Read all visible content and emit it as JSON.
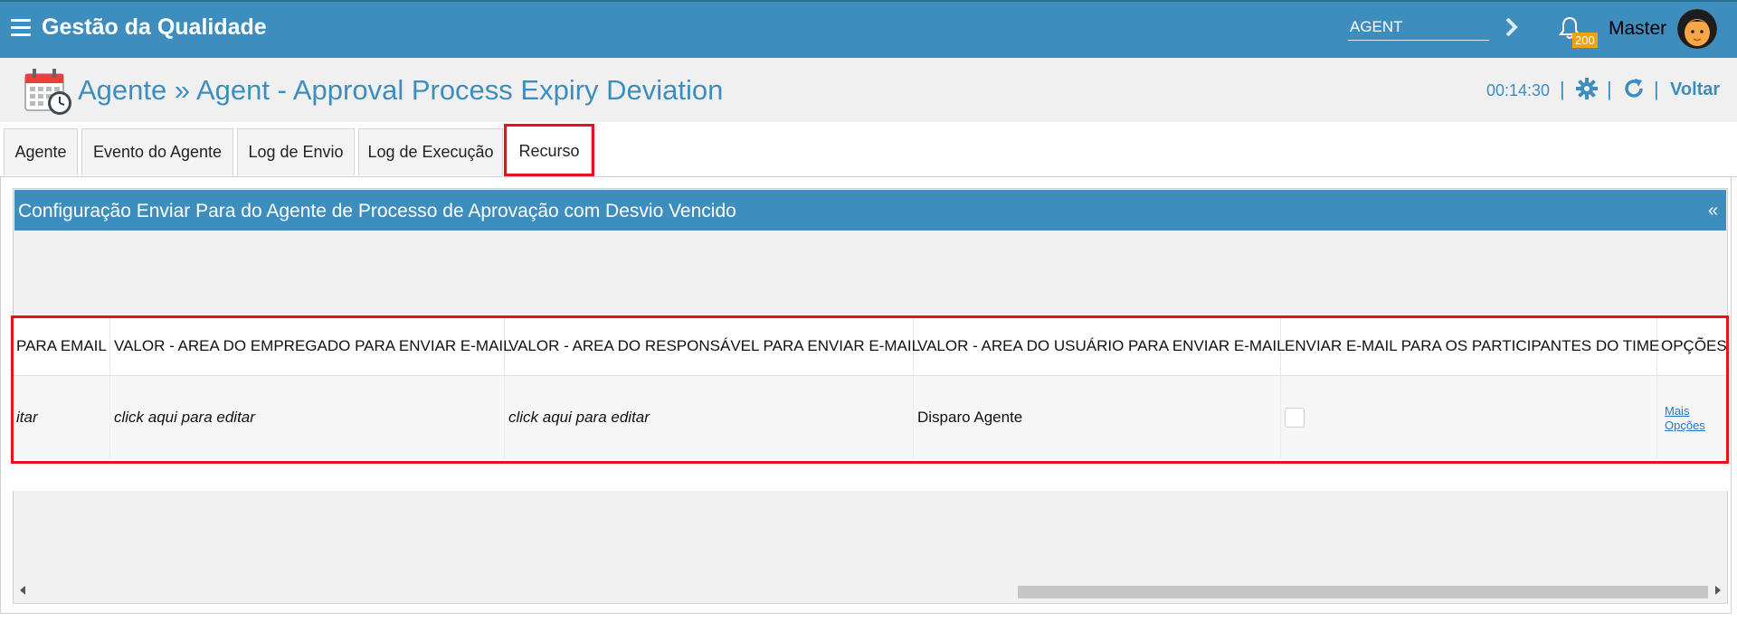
{
  "topbar": {
    "app_title": "Gestão da Qualidade",
    "search_value": "AGENT",
    "notification_count": "200",
    "user_name": "Master"
  },
  "header": {
    "title": "Agente » Agent - Approval Process Expiry Deviation",
    "timer": "00:14:30",
    "separator": "|",
    "back_label": "Voltar"
  },
  "tabs": [
    {
      "label": "Agente"
    },
    {
      "label": "Evento do Agente"
    },
    {
      "label": "Log de Envio"
    },
    {
      "label": "Log de Execução"
    },
    {
      "label": "Recurso",
      "active": true
    }
  ],
  "panel": {
    "title": "Configuração Enviar Para do Agente de Processo de Aprovação com Desvio Vencido",
    "collapse_symbol": "«"
  },
  "table": {
    "columns": [
      "PARA EMAIL",
      "VALOR - AREA DO EMPREGADO PARA ENVIAR E-MAIL",
      "VALOR - AREA DO RESPONSÁVEL PARA ENVIAR E-MAIL",
      "VALOR - AREA DO USUÁRIO PARA ENVIAR E-MAIL",
      "ENVIAR E-MAIL PARA OS PARTICIPANTES DO TIME",
      "OPÇÕES"
    ],
    "row": {
      "col1": "itar",
      "col2": "click aqui para editar",
      "col3": "click aqui para editar",
      "col4": "Disparo Agente",
      "more_options": "Mais Opções"
    }
  },
  "colors": {
    "brand": "#3d8ebf",
    "highlight": "#e8121d",
    "badge": "#f0a30a"
  }
}
